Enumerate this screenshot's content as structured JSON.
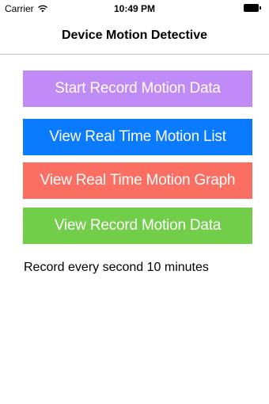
{
  "status_bar": {
    "carrier": "Carrier",
    "time": "10:49 PM",
    "wifi_icon": "wifi-icon",
    "battery_icon": "battery-icon"
  },
  "nav": {
    "title": "Device Motion Detective"
  },
  "buttons": {
    "start_record": {
      "label": "Start Record Motion Data",
      "color": "#c08af7"
    },
    "real_time_list": {
      "label": "View Real Time Motion List",
      "color": "#0a7afe"
    },
    "real_time_graph": {
      "label": "View Real Time Motion Graph",
      "color": "#fb6e62"
    },
    "record_data": {
      "label": "View Record Motion Data",
      "color": "#72cd4a"
    }
  },
  "info": {
    "text": "Record every second 10 minutes"
  }
}
